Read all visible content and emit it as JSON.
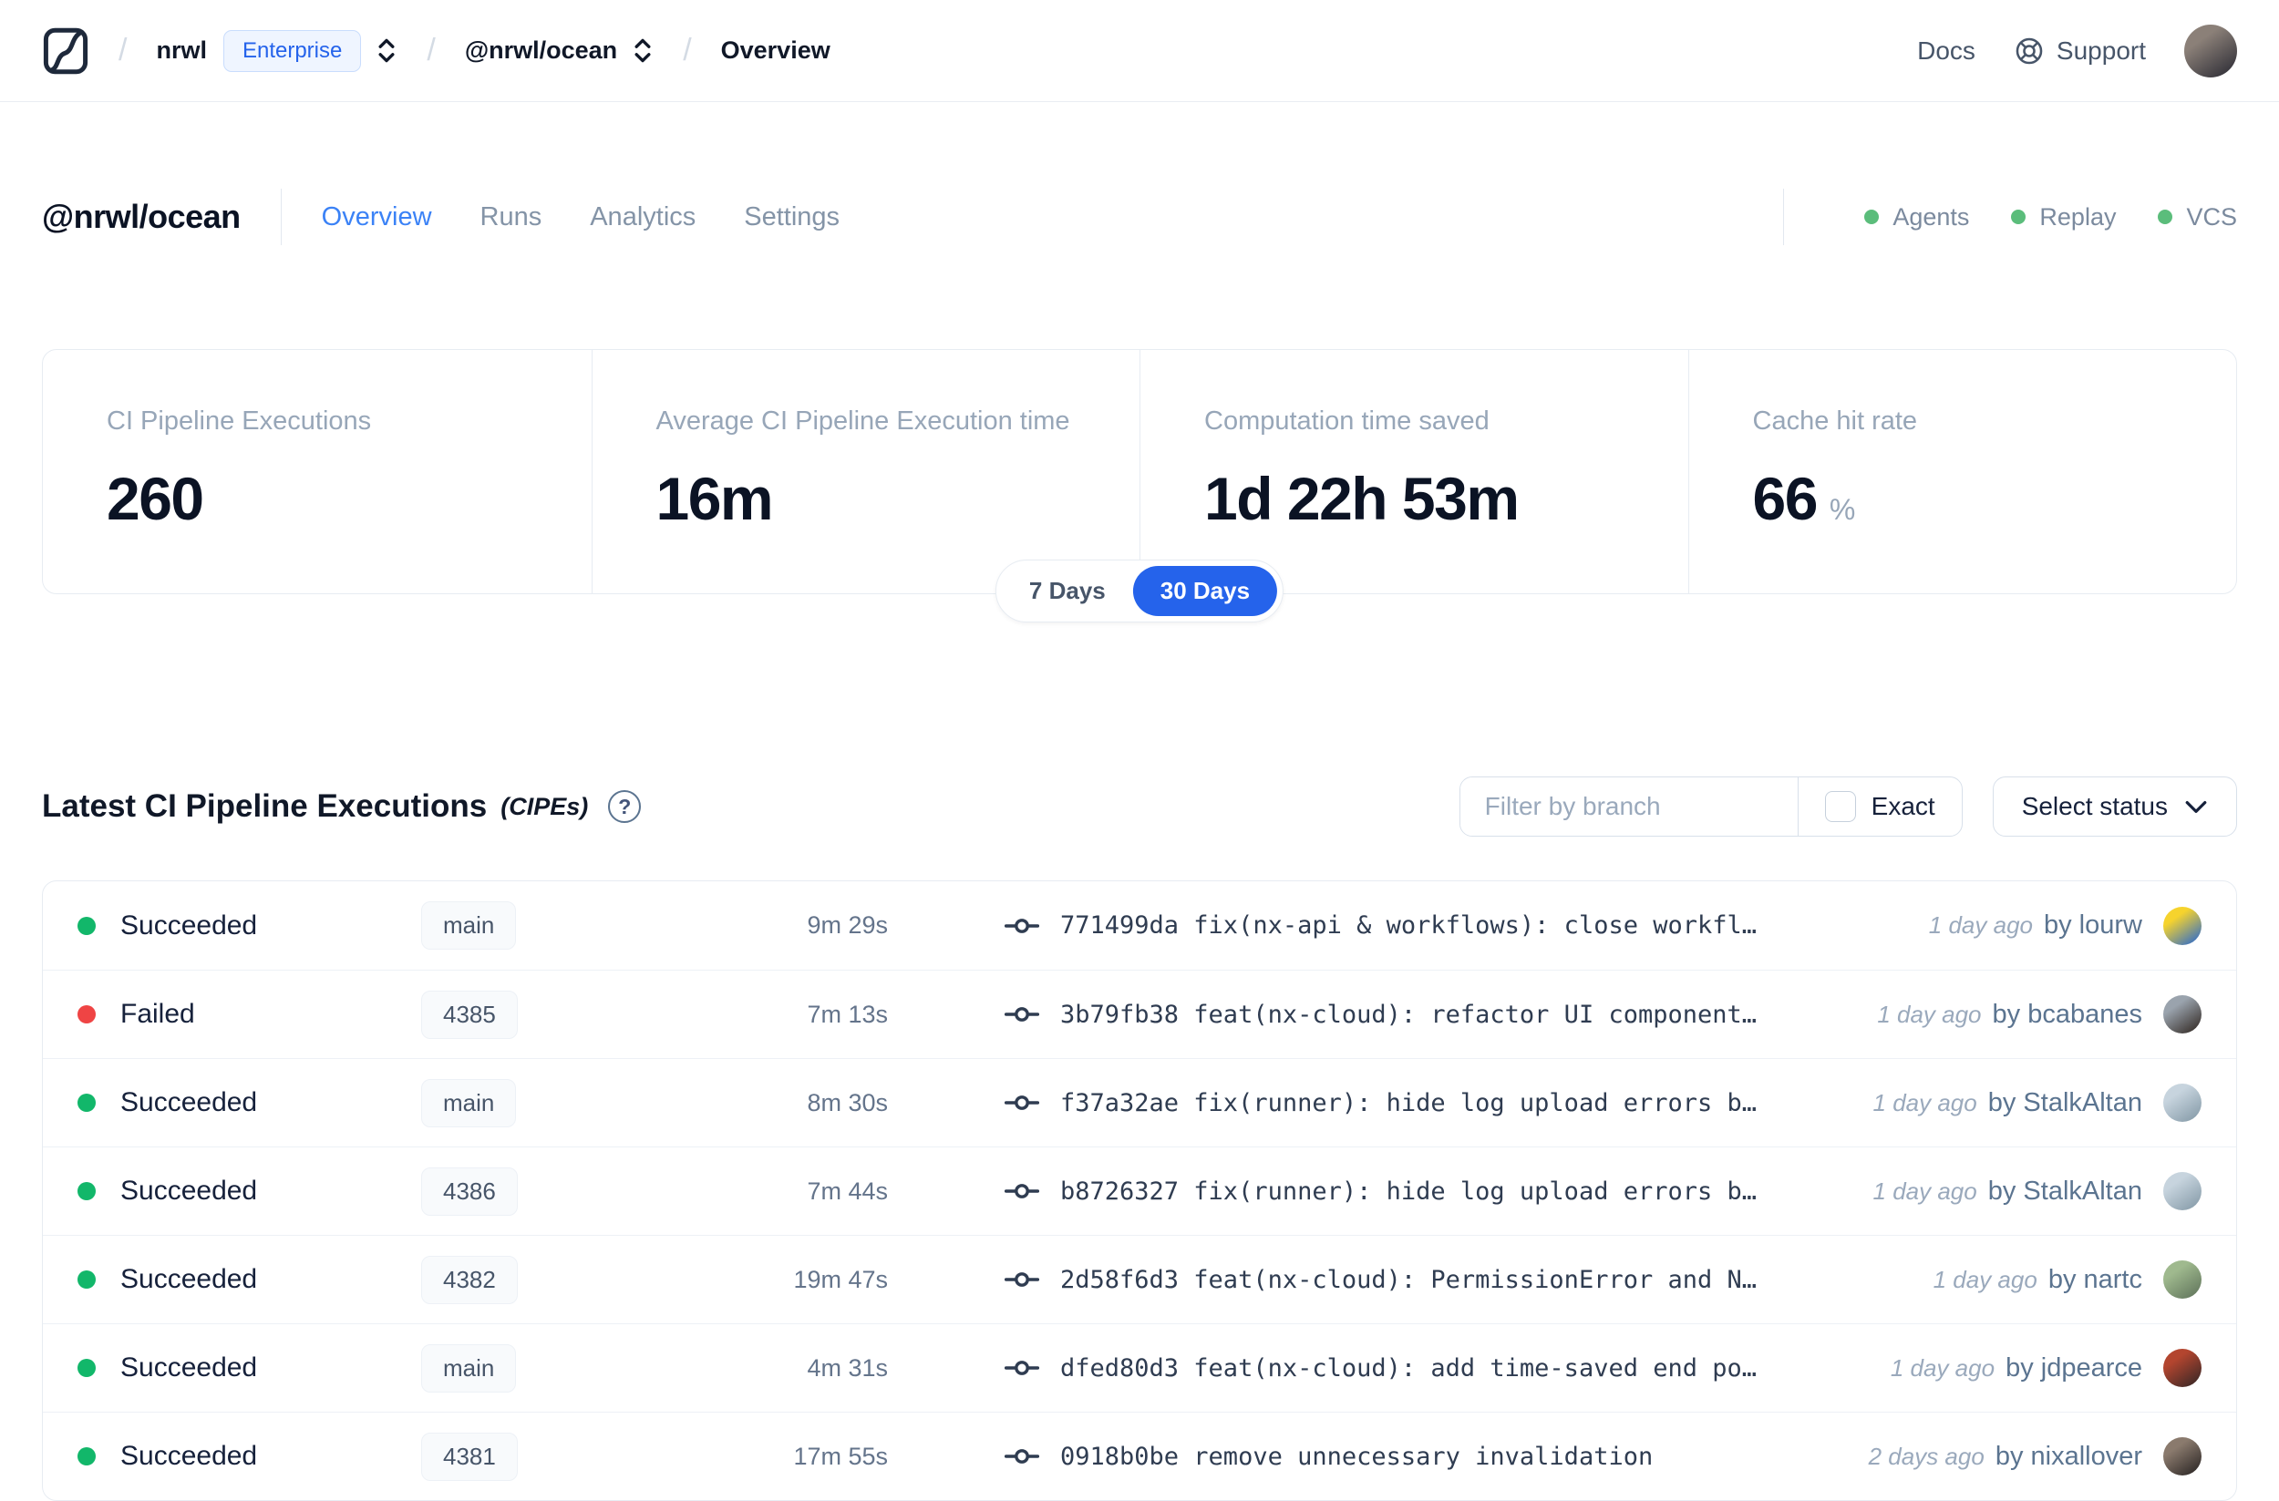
{
  "nav": {
    "breadcrumb": {
      "separator": "/",
      "org": "nrwl",
      "org_badge": "Enterprise",
      "workspace": "@nrwl/ocean",
      "page": "Overview"
    },
    "links": {
      "docs": "Docs",
      "support": "Support"
    },
    "avatar": {
      "c1": "#8b8078",
      "c2": "#3c3a40"
    }
  },
  "workspace_header": {
    "title": "@nrwl/ocean",
    "tabs": [
      {
        "label": "Overview",
        "active": true
      },
      {
        "label": "Runs",
        "active": false
      },
      {
        "label": "Analytics",
        "active": false
      },
      {
        "label": "Settings",
        "active": false
      }
    ],
    "indicators": [
      {
        "label": "Agents",
        "dot_color": "#5bbd7b"
      },
      {
        "label": "Replay",
        "dot_color": "#5bbd7b"
      },
      {
        "label": "VCS",
        "dot_color": "#5bbd7b"
      }
    ]
  },
  "stats": {
    "cards": [
      {
        "label": "CI Pipeline Executions",
        "value": "260",
        "suffix": ""
      },
      {
        "label": "Average CI Pipeline Execution time",
        "value": "16m",
        "suffix": ""
      },
      {
        "label": "Computation time saved",
        "value": "1d 22h 53m",
        "suffix": ""
      },
      {
        "label": "Cache hit rate",
        "value": "66",
        "suffix": "%"
      }
    ],
    "range_toggle": {
      "options": [
        "7 Days",
        "30 Days"
      ],
      "selected": "30 Days"
    }
  },
  "executions": {
    "title": "Latest CI Pipeline Executions",
    "title_suffix": "(CIPEs)",
    "help_glyph": "?",
    "filter": {
      "branch_placeholder": "Filter by branch",
      "branch_value": "",
      "exact_label": "Exact",
      "exact_checked": false,
      "status_button": "Select status"
    },
    "rows": [
      {
        "status": "Succeeded",
        "status_color": "#12b76a",
        "branch": "main",
        "duration": "9m 29s",
        "commit": "771499da fix(nx-api & workflows): close workfl…",
        "time_ago": "1 day ago",
        "author": "by lourw",
        "avatar": {
          "c1": "#f6d32d",
          "c2": "#4a7ab5"
        }
      },
      {
        "status": "Failed",
        "status_color": "#ef4444",
        "branch": "4385",
        "duration": "7m 13s",
        "commit": "3b79fb38 feat(nx-cloud): refactor UI component…",
        "time_ago": "1 day ago",
        "author": "by bcabanes",
        "avatar": {
          "c1": "#9aa3ad",
          "c2": "#433d3a"
        }
      },
      {
        "status": "Succeeded",
        "status_color": "#12b76a",
        "branch": "main",
        "duration": "8m 30s",
        "commit": "f37a32ae fix(runner): hide log upload errors b…",
        "time_ago": "1 day ago",
        "author": "by StalkAltan",
        "avatar": {
          "c1": "#c7d4de",
          "c2": "#8fa3b0"
        }
      },
      {
        "status": "Succeeded",
        "status_color": "#12b76a",
        "branch": "4386",
        "duration": "7m 44s",
        "commit": "b8726327 fix(runner): hide log upload errors b…",
        "time_ago": "1 day ago",
        "author": "by StalkAltan",
        "avatar": {
          "c1": "#c7d4de",
          "c2": "#8fa3b0"
        }
      },
      {
        "status": "Succeeded",
        "status_color": "#12b76a",
        "branch": "4382",
        "duration": "19m 47s",
        "commit": "2d58f6d3 feat(nx-cloud): PermissionError and N…",
        "time_ago": "1 day ago",
        "author": "by nartc",
        "avatar": {
          "c1": "#9fb98e",
          "c2": "#6a7f63"
        }
      },
      {
        "status": "Succeeded",
        "status_color": "#12b76a",
        "branch": "main",
        "duration": "4m 31s",
        "commit": "dfed80d3 feat(nx-cloud): add time-saved end po…",
        "time_ago": "1 day ago",
        "author": "by jdpearce",
        "avatar": {
          "c1": "#b3452f",
          "c2": "#4a2c28"
        }
      },
      {
        "status": "Succeeded",
        "status_color": "#12b76a",
        "branch": "4381",
        "duration": "17m 55s",
        "commit": "0918b0be remove unnecessary invalidation",
        "time_ago": "2 days ago",
        "author": "by nixallover",
        "avatar": {
          "c1": "#8a7a6d",
          "c2": "#3a3330"
        }
      }
    ]
  },
  "icons": {
    "logo": "nx-cloud-logo",
    "breadcrumb_selector": "chevron-up-down",
    "support": "life-buoy",
    "help": "question-circle",
    "commit": "git-commit",
    "dropdown": "chevron-down"
  },
  "colors": {
    "accent_blue": "#2563eb",
    "tab_active_blue": "#3b82f6",
    "success_green": "#12b76a",
    "failure_red": "#ef4444",
    "indicator_green": "#5bbd7b"
  }
}
